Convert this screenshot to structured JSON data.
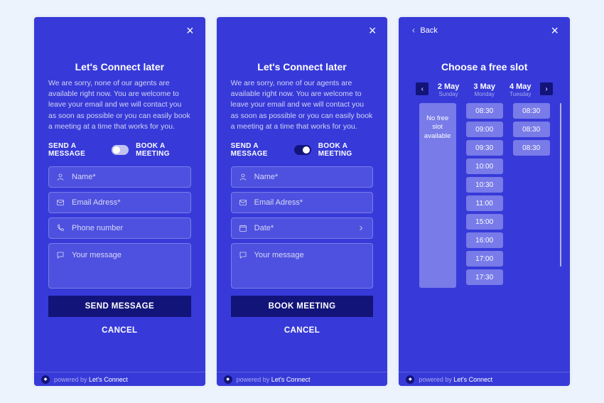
{
  "common": {
    "title": "Let's Connect later",
    "desc": "We are sorry, none of our agents are available right now. You are welcome to leave your email and we will contact you as soon as possible or you can easily book a meeting at a time that works for you.",
    "toggle_left": "SEND A MESSAGE",
    "toggle_right": "BOOK A MEETING",
    "cancel": "CANCEL",
    "footer_text": "powered by ",
    "footer_brand": "Let's Connect"
  },
  "panel1": {
    "name_ph": "Name*",
    "email_ph": "Email Adress*",
    "phone_ph": "Phone number",
    "msg_ph": "Your message",
    "primary": "SEND MESSAGE"
  },
  "panel2": {
    "name_ph": "Name*",
    "email_ph": "Email Adress*",
    "date_ph": "Date*",
    "msg_ph": "Your message",
    "primary": "BOOK MEETING"
  },
  "panel3": {
    "back": "Back",
    "title": "Choose a free slot",
    "days": [
      {
        "label": "2 May",
        "sub": "Sunday"
      },
      {
        "label": "3 May",
        "sub": "Monday"
      },
      {
        "label": "4 May",
        "sub": "Tuesday"
      }
    ],
    "nofree": "No free slot available",
    "col2": [
      "08:30",
      "09:00",
      "09:30",
      "10:00",
      "10:30",
      "11:00",
      "15:00",
      "16:00",
      "17:00",
      "17:30"
    ],
    "col3": [
      "08:30",
      "08:30",
      "08:30"
    ]
  }
}
